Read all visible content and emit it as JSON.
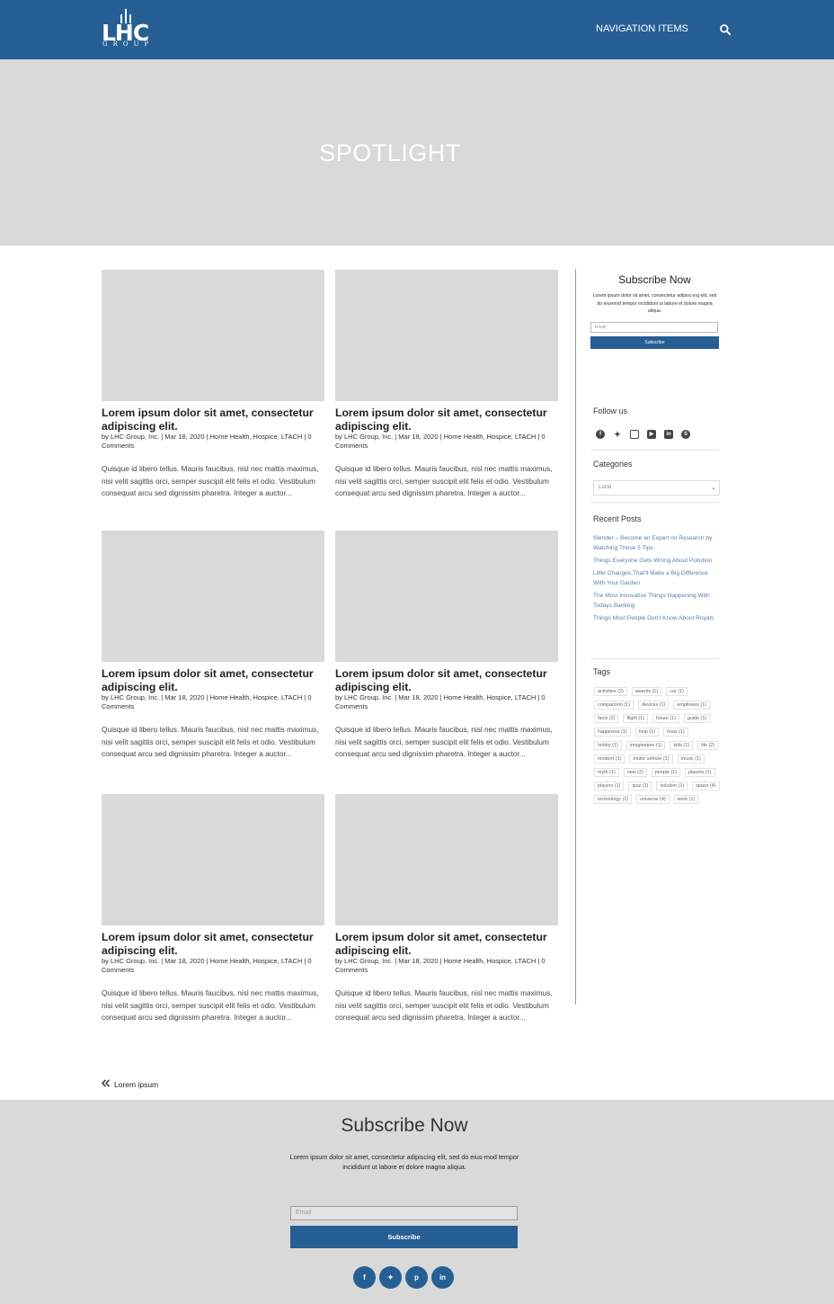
{
  "header": {
    "logo_text": "LHC",
    "logo_subtext": "GROUP",
    "nav_label": "NAVIGATION ITEMS",
    "search_icon": "search-icon"
  },
  "hero": {
    "title": "SPOTLIGHT"
  },
  "posts": [
    {
      "title": "Lorem ipsum dolor sit amet, consectetur adipiscing elit.",
      "meta": "by LHC Group, Inc. | Mar 18, 2020 | Home Health, Hospice, LTACH | 0 Comments",
      "excerpt": "Quisque id libero tellus. Mauris faucibus, nisl nec mattis maximus, nisi velit sagittis orci, semper suscipit elit felis et odio. Vestibulum consequat arcu sed dignissim pharetra. Integer a auctor..."
    },
    {
      "title": "Lorem ipsum dolor sit amet, consectetur adipiscing elit.",
      "meta": "by LHC Group, Inc. | Mar 18, 2020 | Home Health, Hospice, LTACH | 0 Comments",
      "excerpt": "Quisque id libero tellus. Mauris faucibus, nisl nec mattis maximus, nisi velit sagittis orci, semper suscipit elit felis et odio. Vestibulum consequat arcu sed dignissim pharetra. Integer a auctor..."
    },
    {
      "title": "Lorem ipsum dolor sit amet, consectetur adipiscing elit.",
      "meta": "by LHC Group, Inc. | Mar 18, 2020 | Home Health, Hospice, LTACH | 0 Comments",
      "excerpt": "Quisque id libero tellus. Mauris faucibus, nisl nec mattis maximus, nisi velit sagittis orci, semper suscipit elit felis et odio. Vestibulum consequat arcu sed dignissim pharetra. Integer a auctor..."
    },
    {
      "title": "Lorem ipsum dolor sit amet, consectetur adipiscing elit.",
      "meta": "by LHC Group, Inc. | Mar 18, 2020 | Home Health, Hospice, LTACH | 0 Comments",
      "excerpt": "Quisque id libero tellus. Mauris faucibus, nisl nec mattis maximus, nisi velit sagittis orci, semper suscipit elit felis et odio. Vestibulum consequat arcu sed dignissim pharetra. Integer a auctor..."
    },
    {
      "title": "Lorem ipsum dolor sit amet, consectetur adipiscing elit.",
      "meta": "by LHC Group, Inc. | Mar 18, 2020 | Home Health, Hospice, LTACH | 0 Comments",
      "excerpt": "Quisque id libero tellus. Mauris faucibus, nisl nec mattis maximus, nisi velit sagittis orci, semper suscipit elit felis et odio. Vestibulum consequat arcu sed dignissim pharetra. Integer a auctor..."
    },
    {
      "title": "Lorem ipsum dolor sit amet, consectetur adipiscing elit.",
      "meta": "by LHC Group, Inc. | Mar 18, 2020 | Home Health, Hospice, LTACH | 0 Comments",
      "excerpt": "Quisque id libero tellus. Mauris faucibus, nisl nec mattis maximus, nisi velit sagittis orci, semper suscipit elit felis et odio. Vestibulum consequat arcu sed dignissim pharetra. Integer a auctor..."
    }
  ],
  "sidebar": {
    "subscribe": {
      "title": "Subscribe Now",
      "text": "Lorem ipsum dolor sit amet, consectetur adipisc-ing elit, sed do eiusmod tempor incididunt ut labore et dolore magna aliqua.",
      "email_placeholder": "Email",
      "button_label": "Subscribe"
    },
    "follow_heading": "Follow us",
    "follow_icons": [
      "facebook-icon",
      "twitter-icon",
      "instagram-icon",
      "youtube-icon",
      "linkedin-icon",
      "skype-icon"
    ],
    "categories_heading": "Categories",
    "categories_selected": "Lucid",
    "recent_heading": "Recent Posts",
    "recent_posts": [
      "Slender – Become an Expert on Research by Watching These 5 Tips",
      "Things Everyone Gets Wrong About Pollution",
      "Little Changes That'll Make a Big Difference With Your Garden",
      "The Most Innovative Things Happening With Todays Banking",
      "Things Most People Don't Know About Royals"
    ],
    "tags_heading": "Tags",
    "tags": [
      "activities (2)",
      "awards (1)",
      "car (1)",
      "comparison (1)",
      "devices (1)",
      "emptiness (1)",
      "facts (2)",
      "flight (1)",
      "future (1)",
      "guide (1)",
      "happiness (1)",
      "help (1)",
      "hoax (1)",
      "hobby (1)",
      "imagination (1)",
      "kids (1)",
      "life (2)",
      "modern (1)",
      "motor vehicle (1)",
      "music (1)",
      "myth (1)",
      "new (2)",
      "people (1)",
      "planets (1)",
      "players (1)",
      "quiz (1)",
      "solution (1)",
      "space (4)",
      "technology (2)",
      "universe (4)",
      "work (1)"
    ]
  },
  "pagination": {
    "prev_label": "Lorem ipsum"
  },
  "footer": {
    "title": "Subscribe Now",
    "text": "Lorem ipsum dolor sit amet, consectetur adipiscing elit, sed do eius-mod tempor incididunt ut labore et dolore magna aliqua.",
    "email_placeholder": "Email",
    "button_label": "Subscribe",
    "social_icons": [
      "facebook-icon",
      "twitter-icon",
      "pinterest-icon",
      "linkedin-icon"
    ]
  },
  "colors": {
    "brand_blue": "#255f94",
    "placeholder_gray": "#d9d9d9"
  }
}
